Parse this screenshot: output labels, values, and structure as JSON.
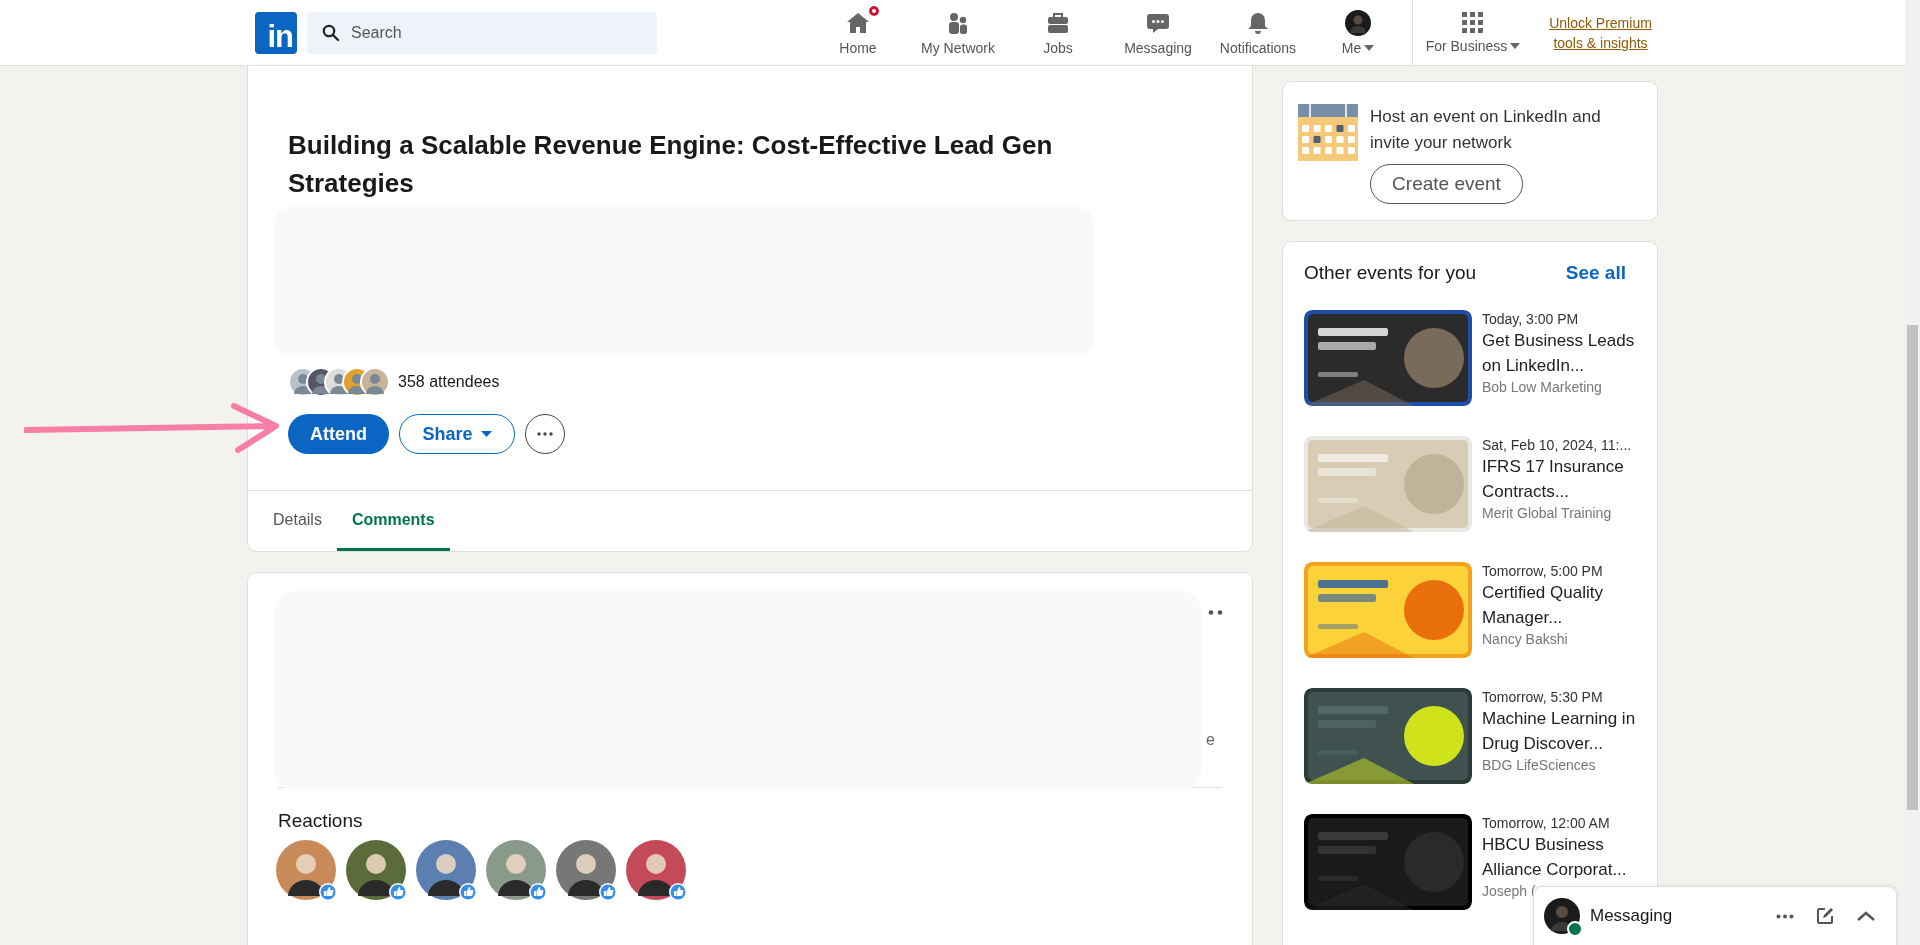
{
  "nav": {
    "logo": "in",
    "search": {
      "placeholder": "Search"
    },
    "items": [
      {
        "kind": "home",
        "label": "Home",
        "alert": true
      },
      {
        "kind": "network",
        "label": "My Network",
        "alert": false
      },
      {
        "kind": "jobs",
        "label": "Jobs",
        "alert": false
      },
      {
        "kind": "messaging",
        "label": "Messaging",
        "alert": false
      },
      {
        "kind": "notifications",
        "label": "Notifications",
        "alert": false
      },
      {
        "kind": "me",
        "label": "Me",
        "alert": false
      }
    ],
    "business": "For Business",
    "premium": "Unlock Premium tools & insights"
  },
  "event": {
    "title": "Building a Scalable Revenue Engine: Cost-Effective Lead Gen Strategies",
    "attendees": "358 attendees",
    "attend": "Attend",
    "share": "Share",
    "tabs": [
      {
        "label": "Details",
        "selected": false
      },
      {
        "label": "Comments",
        "selected": true
      }
    ]
  },
  "comments": {
    "fragment": "e",
    "reactions_title": "Reactions",
    "reactors": [
      {
        "kind": "like"
      },
      {
        "kind": "like"
      },
      {
        "kind": "like"
      },
      {
        "kind": "like"
      },
      {
        "kind": "like"
      },
      {
        "kind": "like"
      }
    ]
  },
  "host_card": {
    "text": "Host an event on LinkedIn and invite your network",
    "button": "Create event"
  },
  "other_events": {
    "title": "Other events for you",
    "see_all": "See all",
    "items": [
      {
        "date": "Today, 3:00 PM",
        "title": "Get Business Leads on LinkedIn...",
        "organizer": "Bob Low Marketing",
        "kind": "picture"
      },
      {
        "date": "Sat, Feb 10, 2024, 11:...",
        "title": "IFRS 17 Insurance Contracts...",
        "organizer": "Merit Global Training",
        "kind": "picture"
      },
      {
        "date": "Tomorrow, 5:00 PM",
        "title": "Certified Quality Manager...",
        "organizer": "Nancy Bakshi",
        "kind": "picture"
      },
      {
        "date": "Tomorrow, 5:30 PM",
        "title": "Machine Learning in Drug Discover...",
        "organizer": "BDG LifeSciences",
        "kind": "picture"
      },
      {
        "date": "Tomorrow, 12:00 AM",
        "title": "HBCU Business Alliance Corporat...",
        "organizer": "Joseph (",
        "kind": "picture"
      }
    ]
  },
  "messaging": {
    "label": "Messaging",
    "online": true
  }
}
